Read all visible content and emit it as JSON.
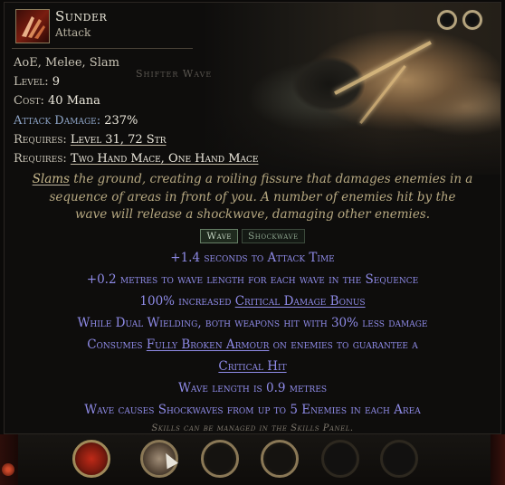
{
  "skill": {
    "name": "Sunder",
    "type": "Attack",
    "tags": "AoE, Melee, Slam",
    "icon": "sunder-skill-icon"
  },
  "art_overlay_text": "Shifter Wave",
  "stats": {
    "level_label": "Level:",
    "level_value": "9",
    "cost_label": "Cost:",
    "cost_value": "40 Mana",
    "attack_damage_label": "Attack Damage:",
    "attack_damage_value": "237%",
    "requires1_label": "Requires:",
    "requires1_value": "Level 31, 72 Str",
    "requires2_label": "Requires:",
    "requires2_value": "Two Hand Mace, One Hand Mace"
  },
  "description": {
    "part1": "Slams",
    "part2": " the ground, creating a roiling fissure that damages enemies in a sequence of areas in front of you. A number of enemies hit by the wave will release a shockwave, damaging other enemies."
  },
  "tabs": [
    {
      "label": "Wave",
      "active": true
    },
    {
      "label": "Shockwave",
      "active": false
    }
  ],
  "modifiers": {
    "m1": "+1.4 seconds to Attack Time",
    "m2": "+0.2 metres to wave length for each wave in the Sequence",
    "m3_a": "100% increased ",
    "m3_b": "Critical Damage Bonus",
    "m4": "While Dual Wielding, both weapons hit with 30% less damage",
    "m5_a": "Consumes ",
    "m5_b": "Fully Broken Armour",
    "m5_c": " on enemies to guarantee a",
    "m5_d": "Critical Hit",
    "m6": "Wave length is 0.9 metres",
    "m7": "Wave causes Shockwaves from up to 5 Enemies in each Area"
  },
  "footer": "Skills can be managed in the Skills Panel.",
  "colors": {
    "modifier_text": "#8f8be8",
    "description_text": "#b6a881",
    "label_blue": "#8fa6c9"
  }
}
